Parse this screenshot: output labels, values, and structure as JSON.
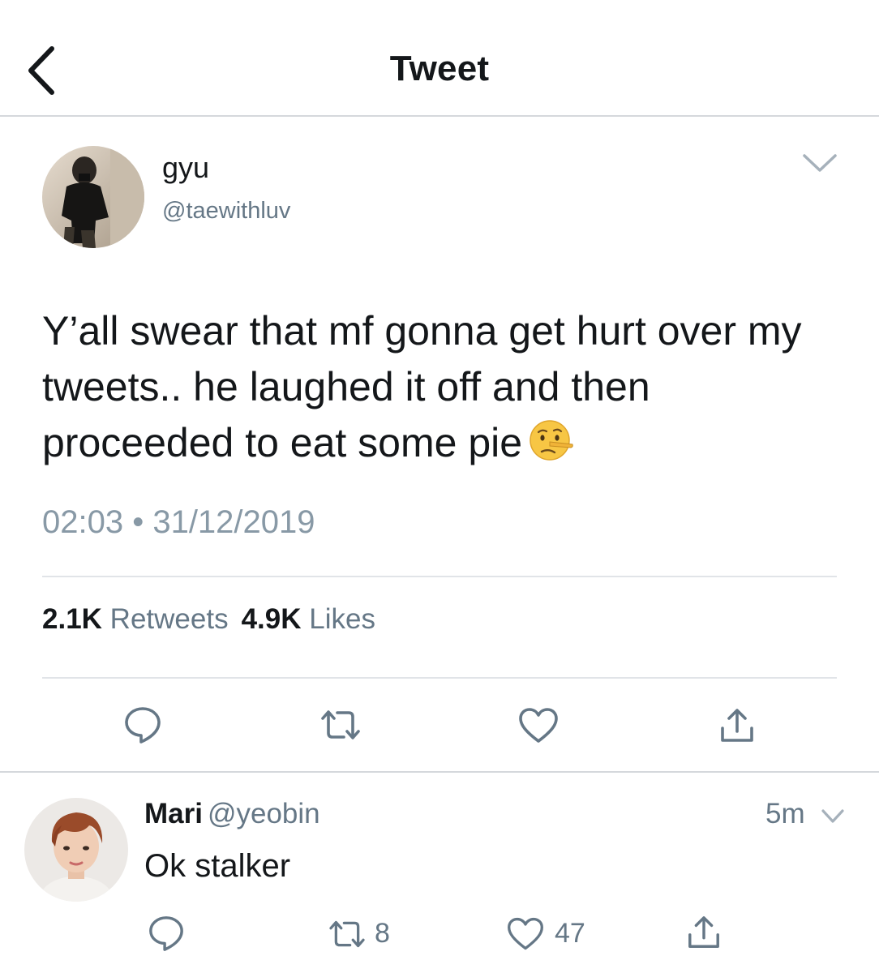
{
  "header": {
    "title": "Tweet"
  },
  "tweet": {
    "display_name": "gyu",
    "handle": "@taewithluv",
    "text": "Y’all swear that mf gonna get hurt over my tweets.. he laughed it off and then proceeded to eat some pie",
    "emoji": "lying-face",
    "timestamp": "02:03 • 31/12/2019",
    "retweets_count": "2.1K",
    "retweets_label": "Retweets",
    "likes_count": "4.9K",
    "likes_label": "Likes"
  },
  "reply": {
    "display_name": "Mari",
    "handle": "@yeobin",
    "time": "5m",
    "text": "Ok stalker",
    "retweet_count": "8",
    "like_count": "47"
  },
  "icons": {
    "back": "chevron-left-icon",
    "more": "chevron-down-icon",
    "reply": "comment-icon",
    "retweet": "retweet-icon",
    "like": "heart-icon",
    "share": "share-icon"
  },
  "colors": {
    "text": "#14171a",
    "secondary": "#657786",
    "timestamp": "#8899a6",
    "divider": "#e1e4e8"
  }
}
